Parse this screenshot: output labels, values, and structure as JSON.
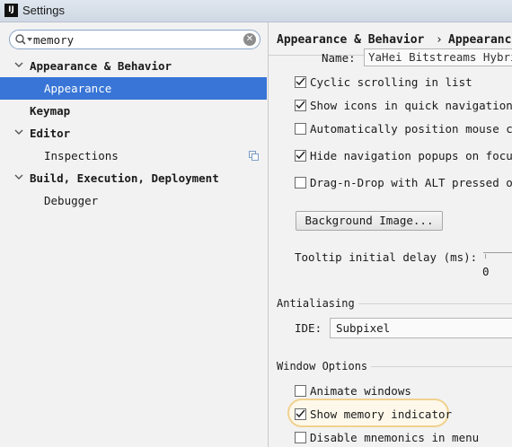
{
  "window": {
    "title": "Settings",
    "app_icon": "IJ"
  },
  "search": {
    "value": "memory"
  },
  "tree": [
    {
      "label": "Appearance & Behavior",
      "bold": true,
      "expanded": true
    },
    {
      "label": "Appearance",
      "selected": true
    },
    {
      "label": "Keymap",
      "bold": true
    },
    {
      "label": "Editor",
      "bold": true,
      "expanded": true
    },
    {
      "label": "Inspections",
      "icon": "copy-icon"
    },
    {
      "label": "Build, Execution, Deployment",
      "bold": true,
      "expanded": true
    },
    {
      "label": "Debugger"
    }
  ],
  "breadcrumb": {
    "parent": "Appearance & Behavior",
    "separator": "›",
    "current": "Appearance"
  },
  "content": {
    "name_label": "Name:",
    "name_value": "YaHei Bitstreams Hybrid",
    "checks": [
      {
        "label": "Cyclic scrolling in list",
        "checked": true
      },
      {
        "label": "Show icons in quick navigation",
        "checked": true
      },
      {
        "label": "Automatically position mouse cur",
        "checked": false
      },
      {
        "label": "Hide navigation popups on focus",
        "checked": true
      },
      {
        "label": "Drag-n-Drop with ALT pressed onl",
        "checked": false
      }
    ],
    "background_button": "Background Image...",
    "tooltip_label": "Tooltip initial delay (ms):",
    "tooltip_tick": "0",
    "antialiasing_title": "Antialiasing",
    "ide_label": "IDE:",
    "ide_value": "Subpixel",
    "window_options_title": "Window Options",
    "window_checks": [
      {
        "label": "Animate windows",
        "checked": false
      },
      {
        "label": "Show memory indicator",
        "checked": true
      },
      {
        "label": "Disable mnemonics in menu",
        "checked": false
      }
    ]
  },
  "colors": {
    "selection": "#3875d6",
    "highlight_border": "#f0d28f"
  }
}
